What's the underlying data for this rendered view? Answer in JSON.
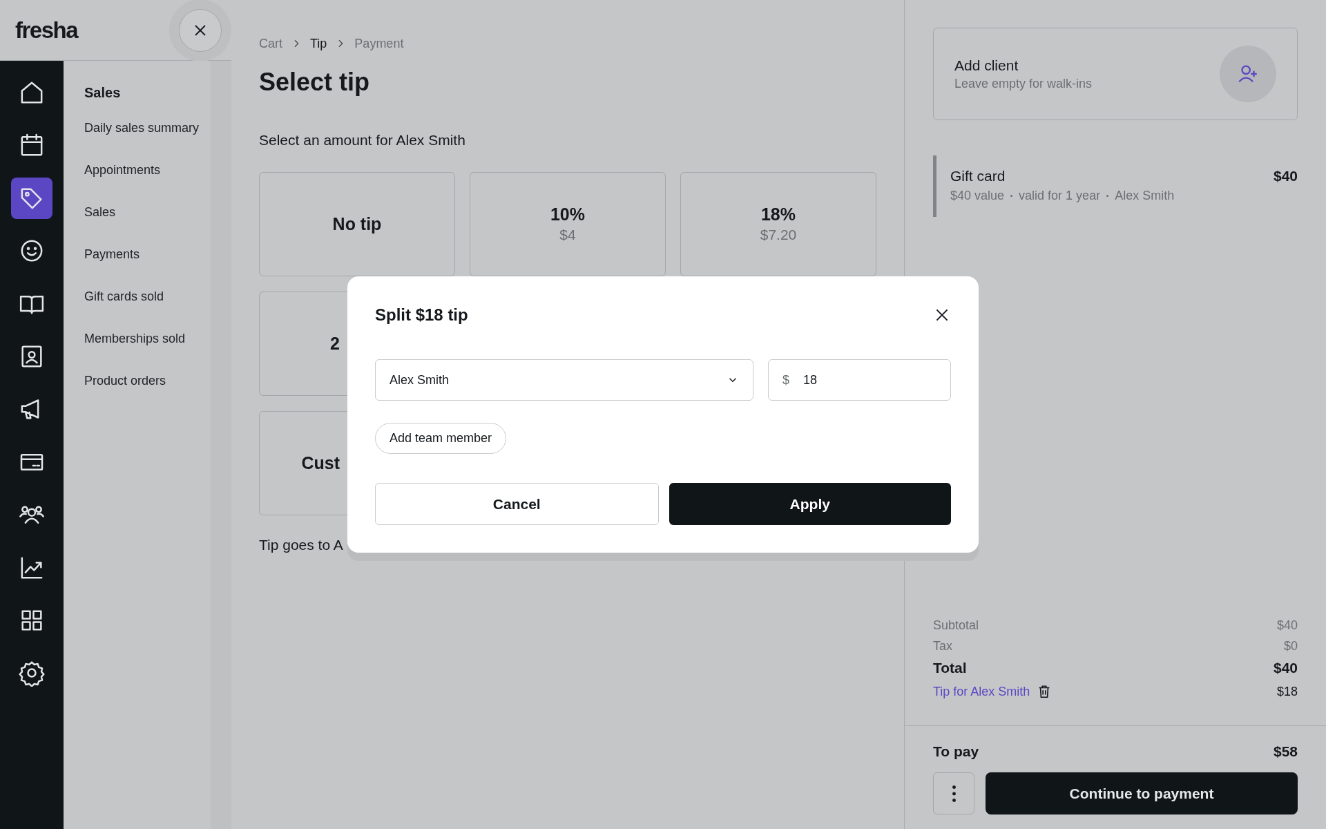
{
  "logo": "fresha",
  "nav_rail": [
    {
      "selected": false
    },
    {
      "selected": false
    },
    {
      "selected": true
    },
    {
      "selected": false
    },
    {
      "selected": false
    },
    {
      "selected": false
    },
    {
      "selected": false
    },
    {
      "selected": false
    },
    {
      "selected": false
    },
    {
      "selected": false
    },
    {
      "selected": false
    },
    {
      "selected": false
    }
  ],
  "submenu": {
    "heading": "Sales",
    "items": [
      "Daily sales summary",
      "Appointments",
      "Sales",
      "Payments",
      "Gift cards sold",
      "Memberships sold",
      "Product orders"
    ]
  },
  "main": {
    "breadcrumb": [
      {
        "label": "Cart",
        "selected": false
      },
      {
        "label": "Tip",
        "selected": true
      },
      {
        "label": "Payment",
        "selected": false
      }
    ],
    "title": "Select tip",
    "subtitle": "Select an amount for Alex Smith",
    "tip_rows": [
      [
        {
          "label": "No tip"
        },
        {
          "label": "10%",
          "amount": "$4"
        },
        {
          "label": "18%",
          "amount": "$7.20"
        }
      ],
      [
        {
          "label": "2"
        }
      ],
      [
        {
          "label": "Cust"
        }
      ]
    ],
    "note": "Tip goes to A"
  },
  "modal": {
    "title": "Split $18 tip",
    "team_member": "Alex Smith",
    "currency": "$",
    "amount": "18",
    "add_button": "Add team member",
    "cancel_button": "Cancel",
    "apply_button": "Apply"
  },
  "cart": {
    "client": {
      "title": "Add client",
      "subtitle": "Leave empty for walk-ins"
    },
    "items": [
      {
        "name": "Gift card",
        "details": [
          "$40 value",
          "valid for 1 year",
          "Alex Smith"
        ],
        "price": "$40"
      }
    ],
    "summary": [
      {
        "kind": "normal",
        "label": "Subtotal",
        "value": "$40"
      },
      {
        "kind": "normal",
        "label": "Tax",
        "value": "$0"
      },
      {
        "kind": "total",
        "label": "Total",
        "value": "$40"
      },
      {
        "kind": "tip",
        "label": "Tip for Alex Smith",
        "value": "$18"
      }
    ],
    "to_pay": {
      "label": "To pay",
      "value": "$58"
    },
    "continue_button": "Continue to payment"
  }
}
